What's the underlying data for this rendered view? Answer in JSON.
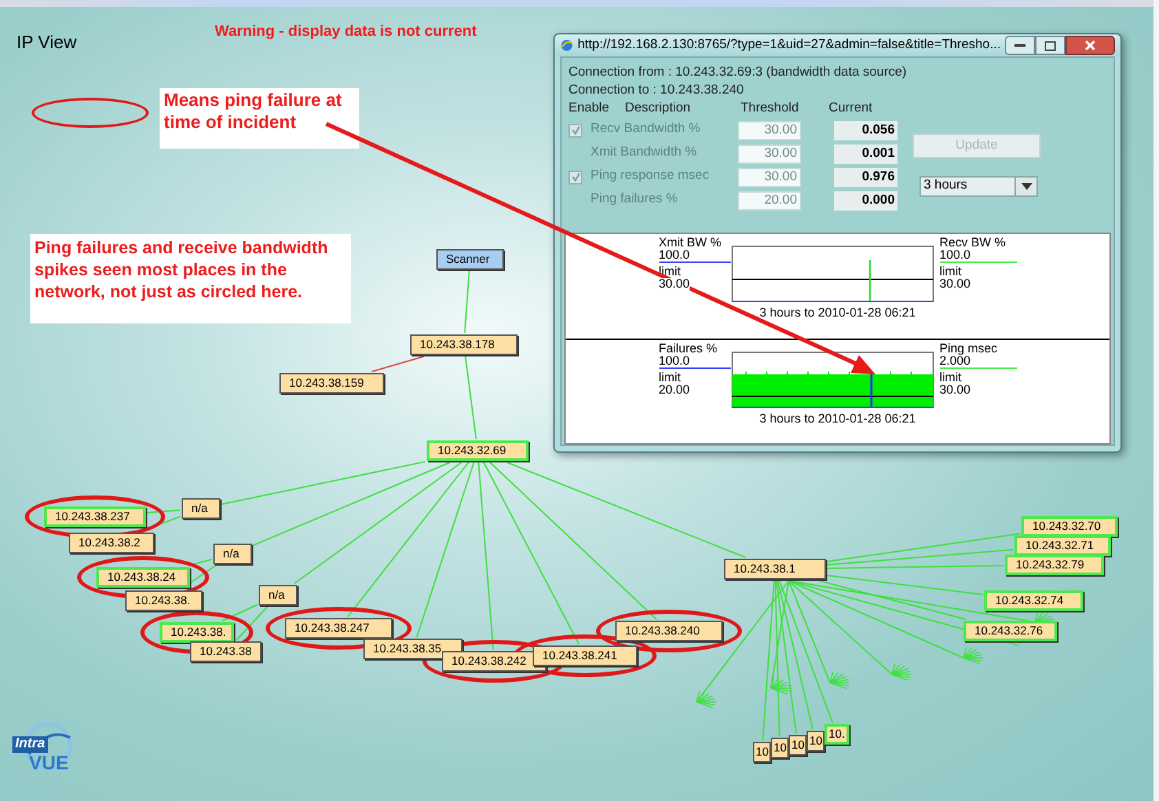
{
  "view_title": "IP View",
  "warning": "Warning - display data is not current",
  "legend": {
    "text": "Means ping failure at time of incident"
  },
  "note": "Ping failures and receive bandwidth spikes seen most places in the network, not just as circled here.",
  "nodes": [
    {
      "label": "Scanner",
      "kind": "scanner",
      "highlighted": false,
      "circled": false
    },
    {
      "label": "10.243.38.178",
      "kind": "device",
      "highlighted": false,
      "circled": false
    },
    {
      "label": "10.243.38.159",
      "kind": "device",
      "highlighted": false,
      "circled": false
    },
    {
      "label": "10.243.32.69",
      "kind": "device",
      "highlighted": true,
      "circled": false
    },
    {
      "label": "10.243.38.237",
      "kind": "device",
      "highlighted": true,
      "circled": true
    },
    {
      "label": "10.243.38.2",
      "kind": "device",
      "highlighted": false,
      "circled": false
    },
    {
      "label": "n/a",
      "kind": "device",
      "highlighted": false,
      "circled": false
    },
    {
      "label": "10.243.38.24",
      "kind": "device",
      "highlighted": true,
      "circled": true
    },
    {
      "label": "10.243.38.",
      "kind": "device",
      "highlighted": false,
      "circled": false
    },
    {
      "label": "n/a",
      "kind": "device",
      "highlighted": false,
      "circled": false
    },
    {
      "label": "n/a",
      "kind": "device",
      "highlighted": false,
      "circled": false
    },
    {
      "label": "10.243.38.",
      "kind": "device",
      "highlighted": true,
      "circled": true
    },
    {
      "label": "10.243.38",
      "kind": "device",
      "highlighted": false,
      "circled": false
    },
    {
      "label": "10.243.38.247",
      "kind": "device",
      "highlighted": false,
      "circled": true
    },
    {
      "label": "10.243.38.35",
      "kind": "device",
      "highlighted": false,
      "circled": false
    },
    {
      "label": "10.243.38.242",
      "kind": "device",
      "highlighted": false,
      "circled": true
    },
    {
      "label": "10.243.38.241",
      "kind": "device",
      "highlighted": false,
      "circled": true
    },
    {
      "label": "10.243.38.240",
      "kind": "device",
      "highlighted": false,
      "circled": true
    },
    {
      "label": "10.243.38.1",
      "kind": "device",
      "highlighted": false,
      "circled": false
    },
    {
      "label": "10.243.32.70",
      "kind": "device",
      "highlighted": true,
      "circled": false
    },
    {
      "label": "10.243.32.71",
      "kind": "device",
      "highlighted": true,
      "circled": false
    },
    {
      "label": "10.243.32.79",
      "kind": "device",
      "highlighted": true,
      "circled": false
    },
    {
      "label": "10.243.32.74",
      "kind": "device",
      "highlighted": true,
      "circled": false
    },
    {
      "label": "10.243.32.76",
      "kind": "device",
      "highlighted": true,
      "circled": false
    },
    {
      "label": "10",
      "kind": "device",
      "highlighted": false,
      "circled": false
    },
    {
      "label": "10",
      "kind": "device",
      "highlighted": false,
      "circled": false
    },
    {
      "label": "10",
      "kind": "device",
      "highlighted": false,
      "circled": false
    },
    {
      "label": "10",
      "kind": "device",
      "highlighted": false,
      "circled": false
    },
    {
      "label": "10.",
      "kind": "device",
      "highlighted": true,
      "circled": false
    }
  ],
  "popup": {
    "title": "http://192.168.2.130:8765/?type=1&uid=27&admin=false&title=Thresho...",
    "connection_from": "Connection from : 10.243.32.69:3 (bandwidth data source)",
    "connection_to": "Connection to : 10.243.38.240",
    "columns": [
      "Enable",
      "Description",
      "Threshold",
      "Current"
    ],
    "rows": [
      {
        "kind": "check",
        "checked": true,
        "description": "Recv Bandwidth %",
        "threshold": "30.00",
        "current": "0.056"
      },
      {
        "kind": "plain",
        "description": "Xmit Bandwidth %",
        "threshold": "30.00",
        "current": "0.001"
      },
      {
        "kind": "check",
        "checked": true,
        "description": "Ping response msec",
        "threshold": "30.00",
        "current": "0.976"
      },
      {
        "kind": "plain",
        "description": "Ping failures %",
        "threshold": "20.00",
        "current": "0.000"
      }
    ],
    "update_button": {
      "label": "Update",
      "disabled": true
    },
    "period": {
      "value": "3 hours"
    },
    "charts": [
      {
        "kind": "spike",
        "left_title": "Xmit BW %",
        "left_max": "100.0",
        "left_limit_label": "limit",
        "left_limit": "30.00",
        "right_title": "Recv BW %",
        "right_max": "100.0",
        "right_limit_label": "limit",
        "right_limit": "30.00",
        "caption": "3 hours to 2010-01-28 06:21"
      },
      {
        "kind": "filled",
        "left_title": "Failures %",
        "left_max": "100.0",
        "left_limit_label": "limit",
        "left_limit": "20.00",
        "right_title": "Ping msec",
        "right_max": "2.000",
        "right_limit_label": "limit",
        "right_limit": "30.00",
        "caption": "3 hours to 2010-01-28 06:21"
      }
    ]
  },
  "logo": {
    "word_1": "Intra",
    "word_2": "VUE"
  }
}
